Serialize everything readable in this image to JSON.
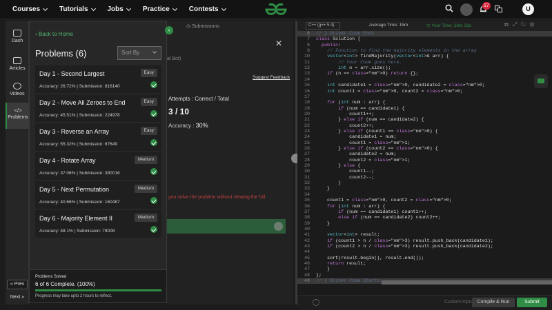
{
  "nav": {
    "items": [
      "Courses",
      "Tutorials",
      "Jobs",
      "Practice",
      "Contests"
    ],
    "notification_count": "17",
    "avatar_letter": "U"
  },
  "rail": {
    "items": [
      {
        "label": "Dash",
        "icon": "dashboard-icon"
      },
      {
        "label": "Articles",
        "icon": "articles-icon"
      },
      {
        "label": "Videos",
        "icon": "videos-icon"
      },
      {
        "label": "Problems",
        "icon": "code-icon"
      }
    ],
    "prev": "Prev",
    "next": "Next"
  },
  "panel": {
    "back": "Back to Home",
    "title": "Problems (6)",
    "sort_placeholder": "Sort By",
    "problems": [
      {
        "name": "Day 1 - Second Largest",
        "difficulty": "Easy",
        "meta": "Accuracy: 26.72% | Submission: 816140"
      },
      {
        "name": "Day 2 - Move All Zeroes to End",
        "difficulty": "Easy",
        "meta": "Accuracy: 45.51% | Submission: 224978"
      },
      {
        "name": "Day 3 - Reverse an Array",
        "difficulty": "Easy",
        "meta": "Accuracy: 55.32% | Submission: 67649"
      },
      {
        "name": "Day 4 - Rotate Array",
        "difficulty": "Medium",
        "meta": "Accuracy: 37.06% | Submission: 390016"
      },
      {
        "name": "Day 5 - Next Permutation",
        "difficulty": "Medium",
        "meta": "Accuracy: 40.66% | Submission: 160487"
      },
      {
        "name": "Day 6 - Majority Element II",
        "difficulty": "Medium",
        "meta": "Accuracy: 48.1% | Submission: 78008"
      }
    ],
    "solved_label": "Problems Solved",
    "solved_text": "6 of 6 Complete. (100%)",
    "solved_progress": 1.0,
    "solved_note": "Progress may take upto 2 hours to reflect."
  },
  "mid": {
    "submissions_tab": "Submissions",
    "bot_label": "al Bot)",
    "feedback": "Suggest Feedback",
    "attempts_label": "Attempts : Correct / Total",
    "score": "3 / 10",
    "accuracy_label": "Accuracy :",
    "accuracy_value": "30%",
    "warning": "you solve the problem without viewing the full"
  },
  "editor": {
    "language": "C++ (g++ 5.4)",
    "avg_time": "Average Time: 15m",
    "your_time": "Your Time: 26m 31s",
    "custom_input": "Custom Input",
    "compile": "Compile & Run",
    "submit": "Submit",
    "lines": [
      {
        "n": "6",
        "t": "// } Driver Code Ends",
        "c": "cm",
        "hl": true
      },
      {
        "n": "7",
        "t": "class Solution {"
      },
      {
        "n": "8",
        "t": "  public:"
      },
      {
        "n": "9",
        "t": "    // Function to find the majority elements in the array",
        "c": "cm"
      },
      {
        "n": "10",
        "t": "    vector<int> findMajority(vector<int>& arr) {"
      },
      {
        "n": "11",
        "t": "        // Your Code goes here.",
        "c": "cm"
      },
      {
        "n": "12",
        "t": "        int n = arr.size();"
      },
      {
        "n": "13",
        "t": "    if (n == 0) return {};"
      },
      {
        "n": "14",
        "t": ""
      },
      {
        "n": "15",
        "t": "    int candidate1 = 0, candidate2 = 0;"
      },
      {
        "n": "16",
        "t": "    int count1 = 0, count2 = 0;"
      },
      {
        "n": "17",
        "t": ""
      },
      {
        "n": "18",
        "t": "    for (int num : arr) {"
      },
      {
        "n": "19",
        "t": "        if (num == candidate1) {"
      },
      {
        "n": "20",
        "t": "            count1++;"
      },
      {
        "n": "21",
        "t": "        } else if (num == candidate2) {"
      },
      {
        "n": "22",
        "t": "            count2++;"
      },
      {
        "n": "23",
        "t": "        } else if (count1 == 0) {"
      },
      {
        "n": "24",
        "t": "            candidate1 = num;"
      },
      {
        "n": "25",
        "t": "            count1 = 1;"
      },
      {
        "n": "26",
        "t": "        } else if (count2 == 0) {"
      },
      {
        "n": "27",
        "t": "            candidate2 = num;"
      },
      {
        "n": "28",
        "t": "            count2 = 1;"
      },
      {
        "n": "29",
        "t": "        } else {"
      },
      {
        "n": "30",
        "t": "            count1--;"
      },
      {
        "n": "31",
        "t": "            count2--;"
      },
      {
        "n": "32",
        "t": "        }"
      },
      {
        "n": "33",
        "t": "    }"
      },
      {
        "n": "34",
        "t": ""
      },
      {
        "n": "35",
        "t": "    count1 = 0, count2 = 0;"
      },
      {
        "n": "36",
        "t": "    for (int num : arr) {"
      },
      {
        "n": "37",
        "t": "        if (num == candidate1) count1++;"
      },
      {
        "n": "38",
        "t": "        else if (num == candidate2) count2++;"
      },
      {
        "n": "39",
        "t": "    }"
      },
      {
        "n": "40",
        "t": ""
      },
      {
        "n": "41",
        "t": "    vector<int> result;"
      },
      {
        "n": "42",
        "t": "    if (count1 > n / 3) result.push_back(candidate1);"
      },
      {
        "n": "43",
        "t": "    if (count2 > n / 3) result.push_back(candidate2);"
      },
      {
        "n": "44",
        "t": ""
      },
      {
        "n": "45",
        "t": "    sort(result.begin(), result.end());"
      },
      {
        "n": "46",
        "t": "    return result;"
      },
      {
        "n": "47",
        "t": "    }"
      },
      {
        "n": "48",
        "t": "};"
      },
      {
        "n": "49",
        "t": "// { Driver Code Starts.",
        "c": "cm",
        "hl": true
      }
    ]
  },
  "colors": {
    "accent": "#2f8d46",
    "bg": "#1c1c1c"
  }
}
